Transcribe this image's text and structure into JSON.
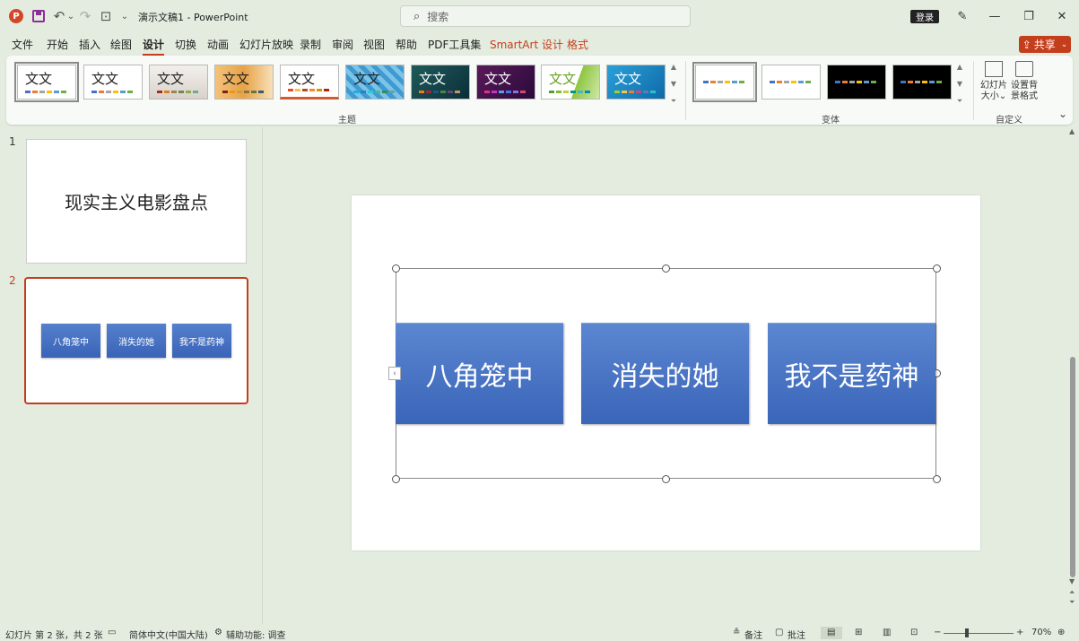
{
  "app": {
    "title": "演示文稿1 - PowerPoint",
    "logo_letter": "P",
    "search_placeholder": "搜索",
    "login_label": "登录",
    "share_label": "共享",
    "accent_color": "#c43e1c"
  },
  "quick_access": {
    "undo": "↶",
    "undo_dropdown": "⌄",
    "redo": "↷",
    "present": "⊡",
    "customize": "⌄"
  },
  "window_controls": {
    "minimize": "—",
    "restore": "❐",
    "close": "✕"
  },
  "menu": {
    "tabs": [
      "文件",
      "开始",
      "插入",
      "绘图",
      "设计",
      "切换",
      "动画",
      "幻灯片放映",
      "录制",
      "审阅",
      "视图",
      "帮助",
      "PDF工具集",
      "SmartArt 设计",
      "格式"
    ],
    "active_tab": "设计"
  },
  "ribbon": {
    "themes_group_label": "主题",
    "variants_group_label": "变体",
    "customize_group_label": "自定义",
    "theme_sample_text": [
      "文文",
      "文文",
      "文文",
      "文文",
      "文文",
      "文文",
      "文文",
      "文文",
      "文文",
      "文文"
    ],
    "slide_size_label": "幻灯片大小",
    "slide_size_caret": "⌄",
    "bg_format_label_line1": "设置背",
    "bg_format_label_line2": "景格式",
    "collapse_glyph": "⌄"
  },
  "slides": [
    {
      "number": "1",
      "title": "现实主义电影盘点"
    },
    {
      "number": "2",
      "items": [
        "八角笼中",
        "消失的她",
        "我不是药神"
      ]
    }
  ],
  "current_slide": {
    "smartart_items": [
      "八角笼中",
      "消失的她",
      "我不是药神"
    ],
    "box_color": "#4472c4"
  },
  "status": {
    "slide_info": "幻灯片 第 2 张，共 2 张",
    "language": "简体中文(中国大陆)",
    "accessibility": "辅助功能: 调查",
    "notes_label": "备注",
    "comments_label": "批注",
    "zoom": "70%"
  }
}
